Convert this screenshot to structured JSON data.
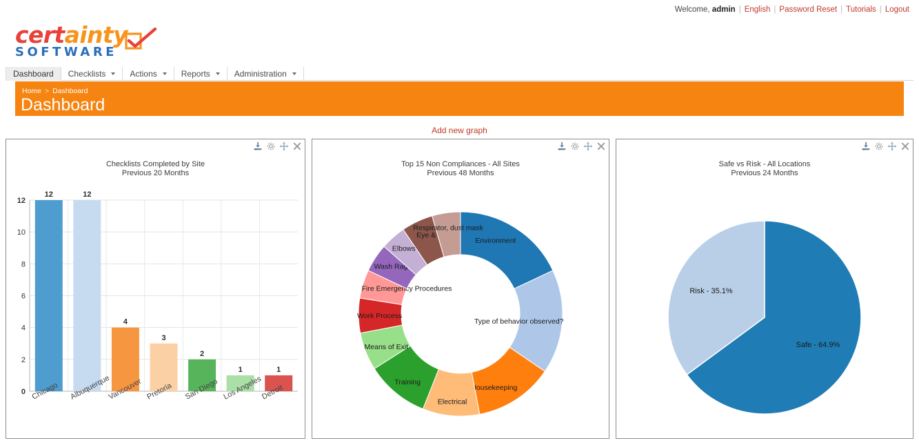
{
  "topbar": {
    "welcome_prefix": "Welcome,",
    "username": "admin",
    "links": [
      {
        "label": "English"
      },
      {
        "label": "Password Reset"
      },
      {
        "label": "Tutorials"
      },
      {
        "label": "Logout"
      }
    ]
  },
  "logo": {
    "part1": "cert",
    "part2": "ainty",
    "tagline": "SOFTWARE"
  },
  "nav": {
    "items": [
      {
        "label": "Dashboard",
        "has_caret": false,
        "active": true
      },
      {
        "label": "Checklists",
        "has_caret": true,
        "active": false
      },
      {
        "label": "Actions",
        "has_caret": true,
        "active": false
      },
      {
        "label": "Reports",
        "has_caret": true,
        "active": false
      },
      {
        "label": "Administration",
        "has_caret": true,
        "active": false
      }
    ]
  },
  "header": {
    "breadcrumb_home": "Home",
    "breadcrumb_sep": ">",
    "breadcrumb_current": "Dashboard",
    "title": "Dashboard",
    "bg_color": "#f58410"
  },
  "actions": {
    "add_new_graph": "Add new graph"
  },
  "panel_tools": {
    "download": "download-icon",
    "settings": "gear-icon",
    "move": "move-icon",
    "close": "close-icon"
  },
  "chart_data": [
    {
      "type": "bar",
      "title": "Checklists Completed by Site",
      "subtitle": "Previous 20 Months",
      "categories": [
        "Chicago",
        "Albuquerque",
        "Vancouver",
        "Pretoria",
        "San Diego",
        "Los Angeles",
        "Detroit"
      ],
      "values": [
        12,
        12,
        4,
        3,
        2,
        1,
        1
      ],
      "colors": [
        "#4f9ccf",
        "#c6dbf0",
        "#f79640",
        "#fbd0a4",
        "#57b45b",
        "#aadfa8",
        "#d9534f"
      ],
      "xlabel": "",
      "ylabel": "",
      "ylim": [
        0,
        12
      ],
      "yticks": [
        0,
        2,
        4,
        6,
        8,
        10,
        12
      ],
      "grid": true,
      "data_labels": true,
      "legend": "none"
    },
    {
      "type": "pie",
      "donut": true,
      "title": "Top 15 Non Compliances - All Sites",
      "subtitle": "Previous 48 Months",
      "labels": [
        "Environment",
        "Type of behavior observed?",
        "Housekeeping",
        "Electrical",
        "Training",
        "Means of Exit",
        "Work Process",
        "Fire Emergency Procedures",
        "Wash Rag",
        "Elbows Out",
        "Eye & face",
        "Respirator, dust mask"
      ],
      "values": [
        18.0,
        16.5,
        12.5,
        9.0,
        10.0,
        6.0,
        5.5,
        4.5,
        4.5,
        4.0,
        5.0,
        4.5
      ],
      "colors": [
        "#1f77b4",
        "#aec7e8",
        "#ff7f0e",
        "#ffbb78",
        "#2ca02c",
        "#98df8a",
        "#d62728",
        "#ff9896",
        "#9467bd",
        "#c5b0d5",
        "#8c564b",
        "#c49c94"
      ],
      "legend": "labels-on-slices"
    },
    {
      "type": "pie",
      "donut": false,
      "title": "Safe vs Risk - All Locations",
      "subtitle": "Previous 24 Months",
      "labels": [
        "Safe - 64.9%",
        "Risk - 35.1%"
      ],
      "slice_names": [
        "Safe",
        "Risk"
      ],
      "values": [
        64.9,
        35.1
      ],
      "colors": [
        "#1f7cb4",
        "#b9cfe7"
      ],
      "legend": "labels-on-slices"
    }
  ]
}
